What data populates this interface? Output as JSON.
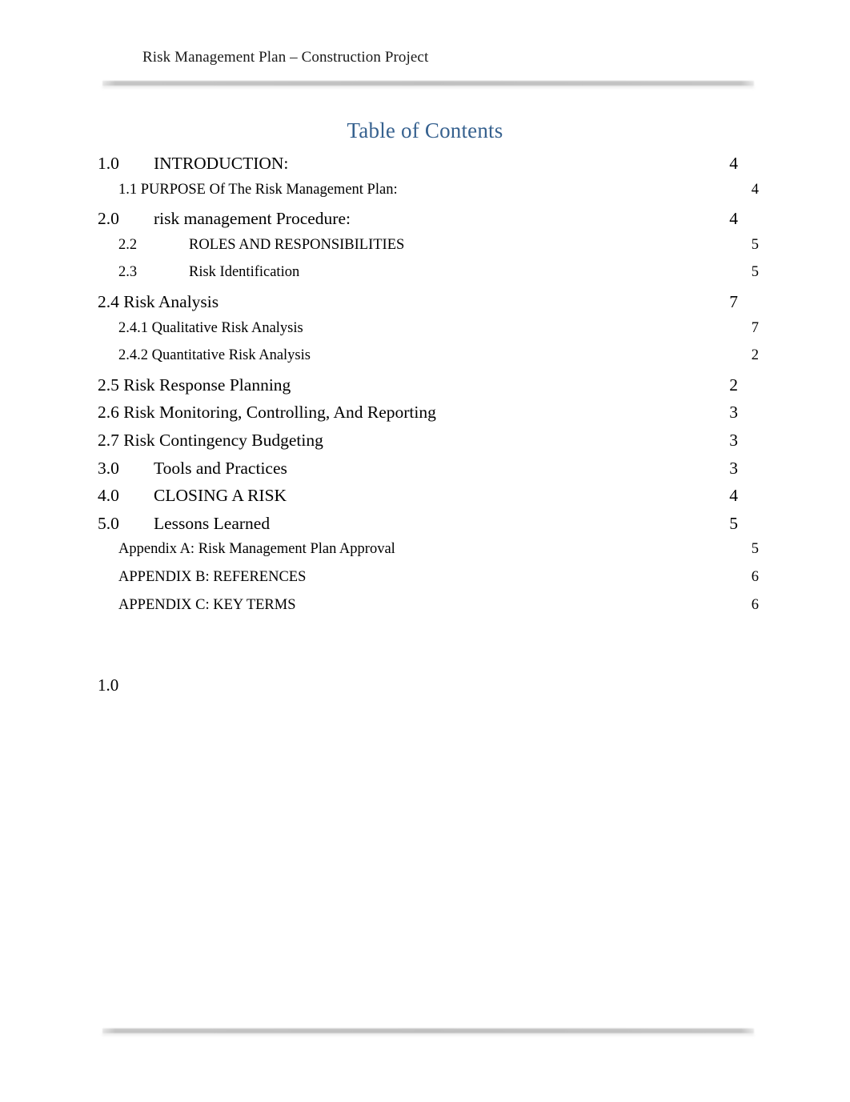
{
  "header": {
    "title": "Risk Management Plan – Construction Project"
  },
  "toc": {
    "title": "Table of Contents",
    "entries": [
      {
        "level": 1,
        "tabbed": true,
        "gap": false,
        "number": "1.0",
        "label": "INTRODUCTION:",
        "page": "4"
      },
      {
        "level": 2,
        "tabbed": false,
        "gap": false,
        "number": "",
        "label": "1.1 PURPOSE Of The Risk Management Plan:",
        "page": "4"
      },
      {
        "level": 1,
        "tabbed": true,
        "gap": true,
        "number": "2.0",
        "label": "risk management Procedure:",
        "page": "4"
      },
      {
        "level": 2,
        "tabbed": true,
        "gap": false,
        "number": "2.2",
        "label": "ROLES AND RESPONSIBILITIES",
        "page": "5"
      },
      {
        "level": 2,
        "tabbed": true,
        "gap": false,
        "number": "2.3",
        "label": "Risk Identification",
        "page": "5"
      },
      {
        "level": 1,
        "tabbed": false,
        "gap": false,
        "number": "",
        "label": "2.4 Risk Analysis",
        "page": "7"
      },
      {
        "level": 2,
        "tabbed": false,
        "gap": false,
        "number": "",
        "label": "2.4.1 Qualitative Risk Analysis",
        "page": "7"
      },
      {
        "level": 2,
        "tabbed": false,
        "gap": true,
        "number": "",
        "label": "2.4.2 Quantitative Risk Analysis",
        "page": "2"
      },
      {
        "level": 1,
        "tabbed": false,
        "gap": false,
        "number": "",
        "label": "2.5 Risk Response Planning",
        "page": "2"
      },
      {
        "level": 1,
        "tabbed": false,
        "gap": false,
        "number": "",
        "label": "2.6 Risk Monitoring, Controlling, And Reporting",
        "page": "3"
      },
      {
        "level": 1,
        "tabbed": false,
        "gap": true,
        "number": "",
        "label": "2.7 Risk Contingency Budgeting",
        "page": "3"
      },
      {
        "level": 1,
        "tabbed": true,
        "gap": true,
        "number": "3.0",
        "label": "Tools and Practices",
        "page": "3"
      },
      {
        "level": 1,
        "tabbed": true,
        "gap": false,
        "number": "4.0",
        "label": "CLOSING A RISK",
        "page": "4"
      },
      {
        "level": 1,
        "tabbed": true,
        "gap": false,
        "number": "5.0",
        "label": "Lessons Learned",
        "page": "5"
      },
      {
        "level": 2,
        "tabbed": false,
        "gap": true,
        "number": "",
        "label": "Appendix A: Risk Management Plan Approval",
        "page": "5"
      },
      {
        "level": 2,
        "tabbed": false,
        "gap": false,
        "number": "",
        "label": "APPENDIX B: REFERENCES",
        "page": "6"
      },
      {
        "level": 2,
        "tabbed": false,
        "gap": false,
        "number": "",
        "label": "APPENDIX C: KEY TERMS",
        "page": "6"
      }
    ]
  },
  "body": {
    "stub": "1.0"
  },
  "colors": {
    "toc_title": "#36618f",
    "rule": "#bdbdbd",
    "text": "#000000"
  }
}
